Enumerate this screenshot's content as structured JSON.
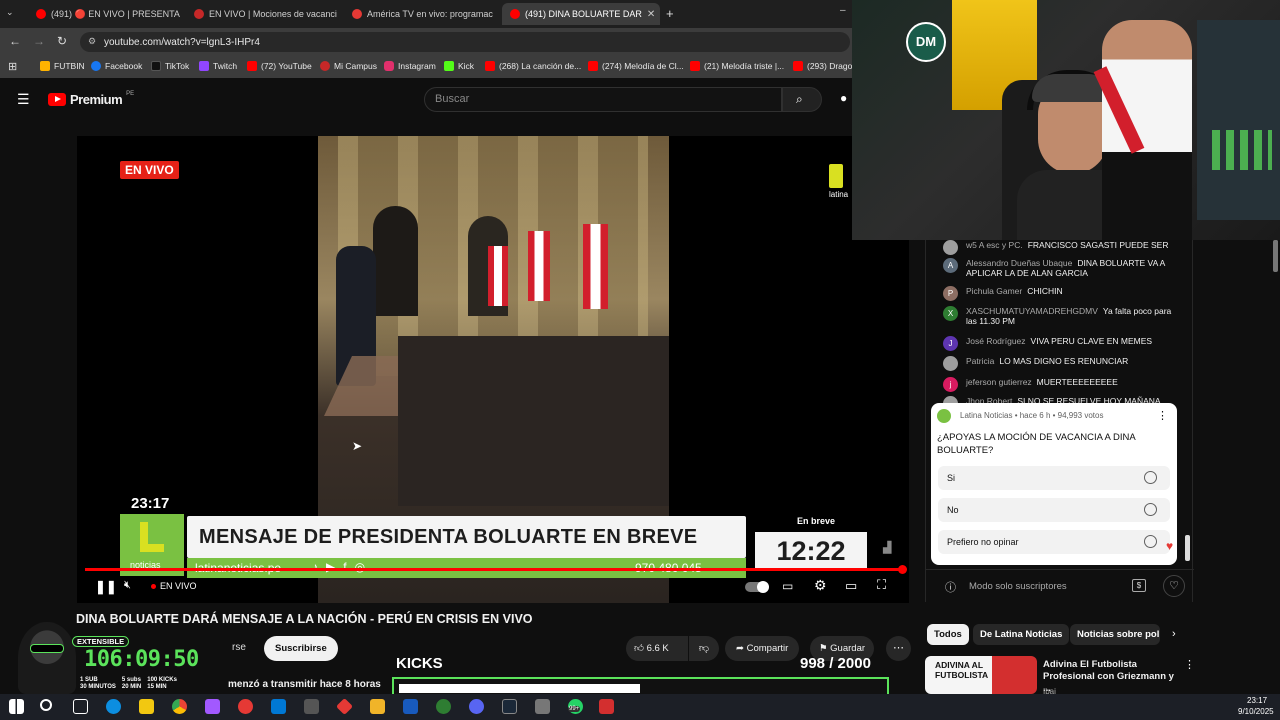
{
  "browser": {
    "tabs": [
      {
        "label": "(491) 🔴 EN VIVO | PRESENTAN",
        "active": false
      },
      {
        "label": "EN VIVO | Mociones de vacanci",
        "active": false
      },
      {
        "label": "América TV en vivo: programac",
        "active": false
      },
      {
        "label": "(491) DINA BOLUARTE DAR",
        "active": true
      }
    ],
    "url": "youtube.com/watch?v=lgnL3-IHPr4",
    "bookmarks": [
      "FUTBIN",
      "Facebook",
      "TikTok",
      "Twitch",
      "(72) YouTube",
      "Mi Campus",
      "Instagram",
      "Kick",
      "(268) La canción de...",
      "(274) Melodía de Cl...",
      "(21) Melodía triste |...",
      "(293) Dragon"
    ]
  },
  "youtube": {
    "logo": "Premium",
    "region": "PE",
    "search_placeholder": "Buscar"
  },
  "video": {
    "live_badge": "EN VIVO",
    "time_overlay": "23:17",
    "channel_bug": "latina",
    "headline": "MENSAJE DE PRESIDENTA BOLUARTE EN BREVE",
    "ticker_site": "latinanoticias.pe",
    "ticker_phone": "970 480 045",
    "en_breve": "En breve",
    "clock": "12:22",
    "logo_text": "noticias",
    "controls_live": "EN VIVO",
    "progress": 1.0
  },
  "title": "DINA BOLUARTE DARÁ MENSAJE A LA NACIÓN - PERÚ EN CRISIS EN VIVO",
  "meta": {
    "subscribe": "Suscribirse",
    "subscribe_left": "rse",
    "likes": "6.6 K",
    "share": "Compartir",
    "save": "Guardar",
    "started": "menzó a transmitir hace 8 horas"
  },
  "overlay": {
    "extensible": "EXTENSIBLE",
    "timer": "106:09:50",
    "small1": "1 SUB",
    "small2": "30 MINUTOS",
    "small3": "5 subs",
    "small4": "20 MIN",
    "small5": "100 KICKs",
    "small6": "15 MIN",
    "kicks_label": "KICKS",
    "kicks_count": "998",
    "kicks_goal": "/ 2000",
    "kicks_progress": 0.499
  },
  "chat": {
    "messages": [
      {
        "author": "w5 A esc y PC.",
        "text": "FRANCISCO SAGASTI PUEDE SER",
        "initial": "",
        "color": "#9e9e9e"
      },
      {
        "author": "Alessandro Dueñas Ubaque",
        "text": "DINA BOLUARTE VA A APLICAR LA DE ALAN GARCIA",
        "initial": "A",
        "color": "#5c6b7a"
      },
      {
        "author": "Pichula Gamer",
        "text": "CHICHIN",
        "initial": "P",
        "color": "#8d6e63"
      },
      {
        "author": "XASCHUMATUYAMADREHGDMV",
        "text": "Ya falta poco para las 11.30 PM",
        "initial": "X",
        "color": "#2e7d32"
      },
      {
        "author": "José Rodríguez",
        "text": "VIVA PERU CLAVE EN MEMES",
        "initial": "J",
        "color": "#5e35b1"
      },
      {
        "author": "Patricia",
        "text": "LO MAS DIGNO ES RENUNCIAR",
        "initial": "",
        "color": "#9e9e9e"
      },
      {
        "author": "jeferson gutierrez",
        "text": "MUERTEEEEEEEEE",
        "initial": "j",
        "color": "#d81b60"
      },
      {
        "author": "Jhon Robert",
        "text": "SI NO SE RESUELVE HOY MAÑANA",
        "initial": "",
        "color": "#9e9e9e"
      }
    ],
    "subscribers_only": "Modo solo suscriptores"
  },
  "poll": {
    "header": "Latina Noticias • hace 6 h • 94,993 votos",
    "question": "¿APOYAS LA MOCIÓN DE VACANCIA A DINA BOLUARTE?",
    "options": [
      "Si",
      "No",
      "Prefiero no opinar"
    ]
  },
  "chips": [
    "Todos",
    "De Latina Noticias",
    "Noticias sobre poli"
  ],
  "recommended": {
    "title": "Adivina El Futbolista Profesional con Griezmann y ...",
    "channel": "Ibai",
    "thumb_text": "ADIVINA AL FUTBOLISTA"
  },
  "taskbar": {
    "time": "23:17",
    "date": "9/10/2025",
    "badge": "99+"
  },
  "colors": {
    "yt_red": "#ff0000",
    "latina_green": "#7ac142",
    "live_red": "#e62117"
  }
}
